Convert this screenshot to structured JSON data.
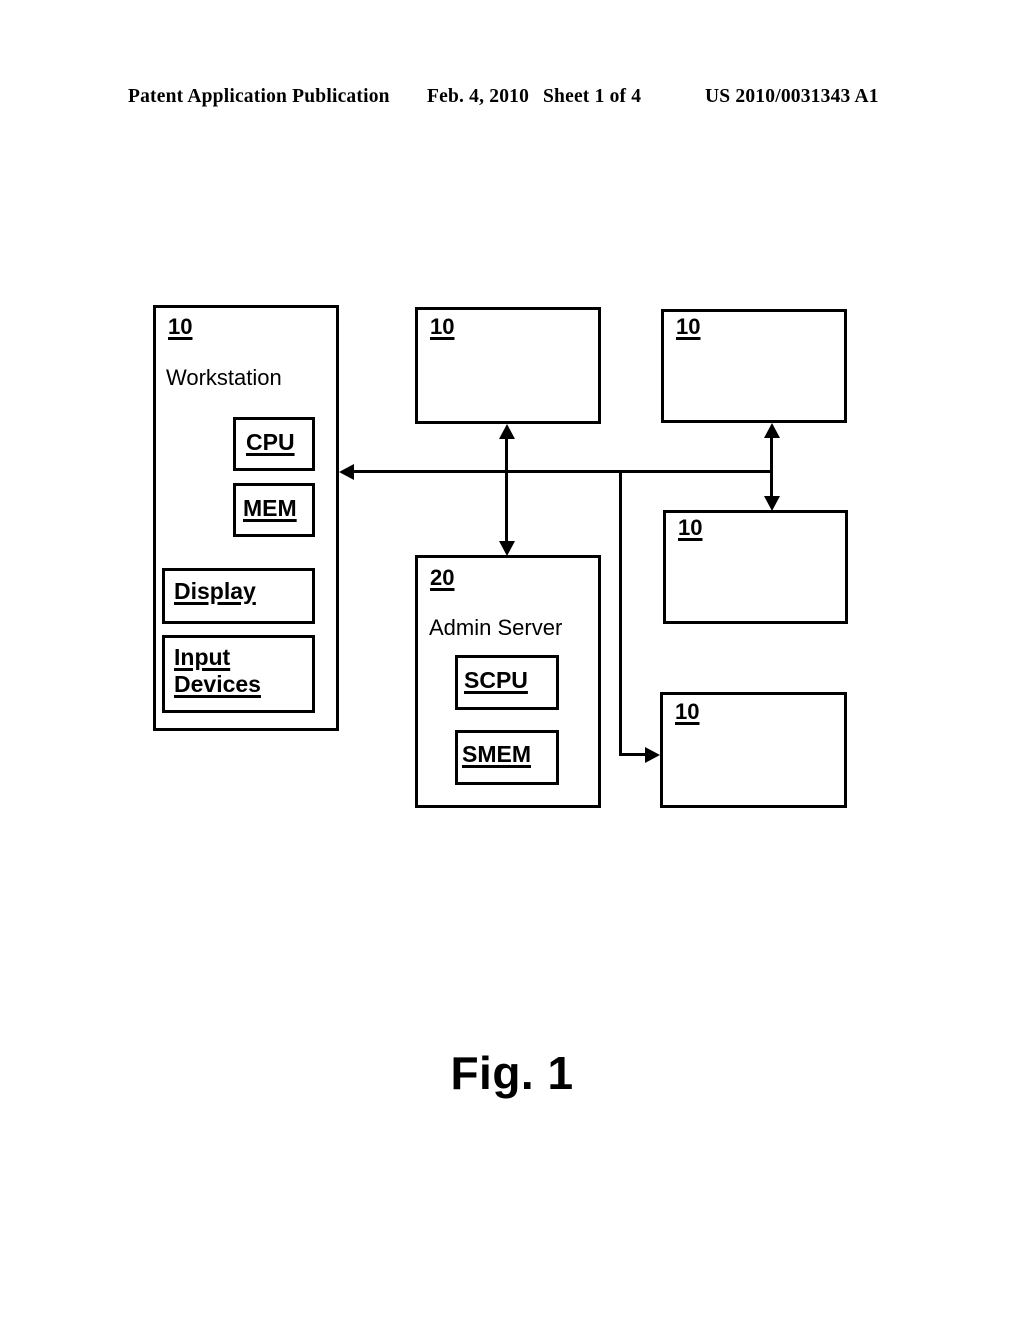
{
  "header": {
    "publication": "Patent Application Publication",
    "date": "Feb. 4, 2010",
    "sheet": "Sheet 1 of 4",
    "patent_number": "US 2010/0031343 A1"
  },
  "figure": {
    "caption": "Fig. 1",
    "ink_color": "#000000",
    "background_color": "#ffffff",
    "workstation": {
      "ref": "10",
      "title": "Workstation",
      "components": [
        {
          "label": "CPU"
        },
        {
          "label": "MEM"
        },
        {
          "label": "Display"
        },
        {
          "label": "Input\nDevices"
        },
        {
          "label_line1": "Input",
          "label_line2": "Devices"
        }
      ],
      "cpu_label": "CPU",
      "mem_label": "MEM",
      "display_label": "Display",
      "input_label_line1": "Input",
      "input_label_line2": "Devices"
    },
    "admin_server": {
      "ref": "20",
      "title": "Admin Server",
      "scpu_label": "SCPU",
      "smem_label": "SMEM"
    },
    "client_boxes": [
      {
        "ref": "10",
        "position": "top-middle"
      },
      {
        "ref": "10",
        "position": "top-right"
      },
      {
        "ref": "10",
        "position": "middle-right"
      },
      {
        "ref": "10",
        "position": "bottom-right"
      }
    ]
  }
}
